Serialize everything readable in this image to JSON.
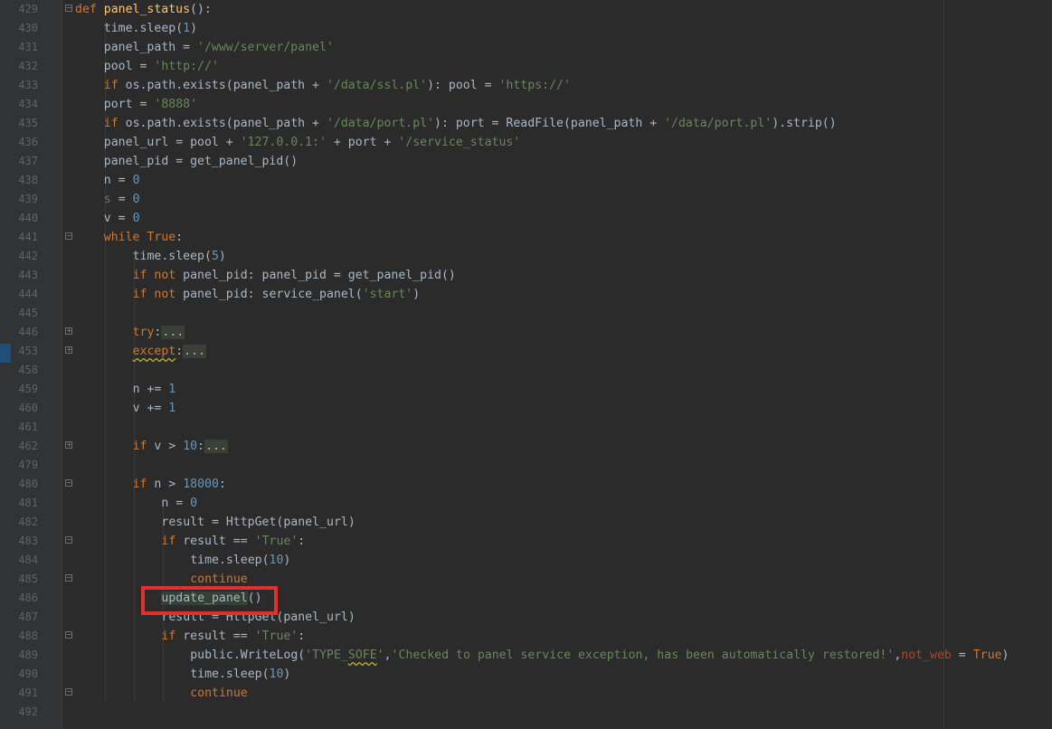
{
  "editor": {
    "language": "python",
    "lines": [
      {
        "no": "429",
        "fold": "open",
        "indent": 0,
        "tokens": [
          [
            "kw",
            "def "
          ],
          [
            "fn",
            "panel_status"
          ],
          [
            "",
            "():"
          ]
        ]
      },
      {
        "no": "430",
        "indent": 4,
        "tokens": [
          [
            "",
            "time.sleep("
          ],
          [
            "num",
            "1"
          ],
          [
            "",
            ")"
          ]
        ]
      },
      {
        "no": "431",
        "indent": 4,
        "tokens": [
          [
            "",
            "panel_path = "
          ],
          [
            "str",
            "'/www/server/panel'"
          ]
        ]
      },
      {
        "no": "432",
        "indent": 4,
        "tokens": [
          [
            "",
            "pool = "
          ],
          [
            "str",
            "'http://'"
          ]
        ]
      },
      {
        "no": "433",
        "indent": 4,
        "tokens": [
          [
            "kw",
            "if "
          ],
          [
            "",
            "os.path.exists(panel_path + "
          ],
          [
            "str",
            "'/data/ssl.pl'"
          ],
          [
            "",
            "): pool = "
          ],
          [
            "str",
            "'https://'"
          ]
        ]
      },
      {
        "no": "434",
        "indent": 4,
        "tokens": [
          [
            "",
            "port = "
          ],
          [
            "str",
            "'8888'"
          ]
        ]
      },
      {
        "no": "435",
        "indent": 4,
        "tokens": [
          [
            "kw",
            "if "
          ],
          [
            "",
            "os.path.exists(panel_path + "
          ],
          [
            "str",
            "'/data/port.pl'"
          ],
          [
            "",
            "): port = ReadFile(panel_path + "
          ],
          [
            "str",
            "'/data/port.pl'"
          ],
          [
            "",
            ").strip()"
          ]
        ]
      },
      {
        "no": "436",
        "indent": 4,
        "tokens": [
          [
            "",
            "panel_url = pool + "
          ],
          [
            "str",
            "'127.0.0.1:'"
          ],
          [
            "",
            " + port + "
          ],
          [
            "str",
            "'/service_status'"
          ]
        ]
      },
      {
        "no": "437",
        "indent": 4,
        "tokens": [
          [
            "",
            "panel_pid = get_panel_pid()"
          ]
        ]
      },
      {
        "no": "438",
        "indent": 4,
        "tokens": [
          [
            "",
            "n = "
          ],
          [
            "num",
            "0"
          ]
        ]
      },
      {
        "no": "439",
        "indent": 4,
        "tokens": [
          [
            "dim",
            "s"
          ],
          [
            "",
            " = "
          ],
          [
            "num",
            "0"
          ]
        ]
      },
      {
        "no": "440",
        "indent": 4,
        "tokens": [
          [
            "",
            "v = "
          ],
          [
            "num",
            "0"
          ]
        ]
      },
      {
        "no": "441",
        "fold": "open",
        "indent": 4,
        "tokens": [
          [
            "kw",
            "while "
          ],
          [
            "kw",
            "True"
          ],
          [
            "",
            ":"
          ]
        ]
      },
      {
        "no": "442",
        "indent": 8,
        "tokens": [
          [
            "",
            "time.sleep("
          ],
          [
            "num",
            "5"
          ],
          [
            "",
            ")"
          ]
        ]
      },
      {
        "no": "443",
        "indent": 8,
        "tokens": [
          [
            "kw",
            "if not "
          ],
          [
            "",
            "panel_pid: panel_pid = get_panel_pid()"
          ]
        ]
      },
      {
        "no": "444",
        "indent": 8,
        "tokens": [
          [
            "kw",
            "if not "
          ],
          [
            "",
            "panel_pid: service_panel("
          ],
          [
            "str",
            "'start'"
          ],
          [
            "",
            ")"
          ]
        ]
      },
      {
        "no": "445",
        "indent": 0,
        "tokens": []
      },
      {
        "no": "446",
        "fold": "closed",
        "indent": 8,
        "tokens": [
          [
            "kw",
            "try"
          ],
          [
            "",
            ":"
          ],
          [
            "fold-ph",
            "..."
          ]
        ]
      },
      {
        "no": "453",
        "fold": "closed",
        "indent": 8,
        "tokens": [
          [
            "kw warn",
            "except"
          ],
          [
            "",
            ":"
          ],
          [
            "fold-ph",
            "..."
          ]
        ]
      },
      {
        "no": "458",
        "indent": 0,
        "tokens": []
      },
      {
        "no": "459",
        "indent": 8,
        "tokens": [
          [
            "",
            "n += "
          ],
          [
            "num",
            "1"
          ]
        ]
      },
      {
        "no": "460",
        "indent": 8,
        "tokens": [
          [
            "",
            "v += "
          ],
          [
            "num",
            "1"
          ]
        ]
      },
      {
        "no": "461",
        "indent": 0,
        "tokens": []
      },
      {
        "no": "462",
        "fold": "closed",
        "indent": 8,
        "tokens": [
          [
            "kw",
            "if "
          ],
          [
            "",
            "v > "
          ],
          [
            "num",
            "10"
          ],
          [
            "",
            ":"
          ],
          [
            "fold-ph",
            "..."
          ]
        ]
      },
      {
        "no": "479",
        "indent": 0,
        "tokens": []
      },
      {
        "no": "480",
        "fold": "open",
        "indent": 8,
        "tokens": [
          [
            "kw",
            "if "
          ],
          [
            "",
            "n > "
          ],
          [
            "num",
            "18000"
          ],
          [
            "",
            ":"
          ]
        ]
      },
      {
        "no": "481",
        "indent": 12,
        "tokens": [
          [
            "",
            "n = "
          ],
          [
            "num",
            "0"
          ]
        ]
      },
      {
        "no": "482",
        "indent": 12,
        "tokens": [
          [
            "",
            "result = HttpGet(panel_url)"
          ]
        ]
      },
      {
        "no": "483",
        "fold": "open",
        "indent": 12,
        "tokens": [
          [
            "kw",
            "if "
          ],
          [
            "",
            "result == "
          ],
          [
            "str",
            "'True'"
          ],
          [
            "",
            ":"
          ]
        ]
      },
      {
        "no": "484",
        "indent": 16,
        "tokens": [
          [
            "",
            "time.sleep("
          ],
          [
            "num",
            "10"
          ],
          [
            "",
            ")"
          ]
        ]
      },
      {
        "no": "485",
        "fold": "open",
        "indent": 16,
        "tokens": [
          [
            "kw",
            "continue"
          ]
        ]
      },
      {
        "no": "486",
        "indent": 12,
        "tokens": [
          [
            "sel",
            "update_panel"
          ],
          [
            "",
            "()"
          ]
        ]
      },
      {
        "no": "487",
        "indent": 12,
        "tokens": [
          [
            "",
            "result = HttpGet(panel_url)"
          ]
        ]
      },
      {
        "no": "488",
        "fold": "open",
        "indent": 12,
        "tokens": [
          [
            "kw",
            "if "
          ],
          [
            "",
            "result == "
          ],
          [
            "str",
            "'True'"
          ],
          [
            "",
            ":"
          ]
        ]
      },
      {
        "no": "489",
        "indent": 16,
        "tokens": [
          [
            "",
            "public.WriteLog("
          ],
          [
            "str",
            "'TYPE_"
          ],
          [
            "str warn",
            "SOFE"
          ],
          [
            "str",
            "'"
          ],
          [
            "",
            ","
          ],
          [
            "str",
            "'Checked to panel service exception, has been automatically restored!'"
          ],
          [
            "",
            ","
          ],
          [
            "param",
            "not_web"
          ],
          [
            "",
            " = "
          ],
          [
            "kw",
            "True"
          ],
          [
            "",
            ")"
          ]
        ]
      },
      {
        "no": "490",
        "indent": 16,
        "tokens": [
          [
            "",
            "time.sleep("
          ],
          [
            "num",
            "10"
          ],
          [
            "",
            ")"
          ]
        ]
      },
      {
        "no": "491",
        "fold": "open",
        "indent": 16,
        "tokens": [
          [
            "kw",
            "continue"
          ]
        ]
      },
      {
        "no": "492",
        "indent": 0,
        "tokens": []
      }
    ]
  },
  "annotation": {
    "label": "highlighted-call",
    "target_line": "486"
  }
}
